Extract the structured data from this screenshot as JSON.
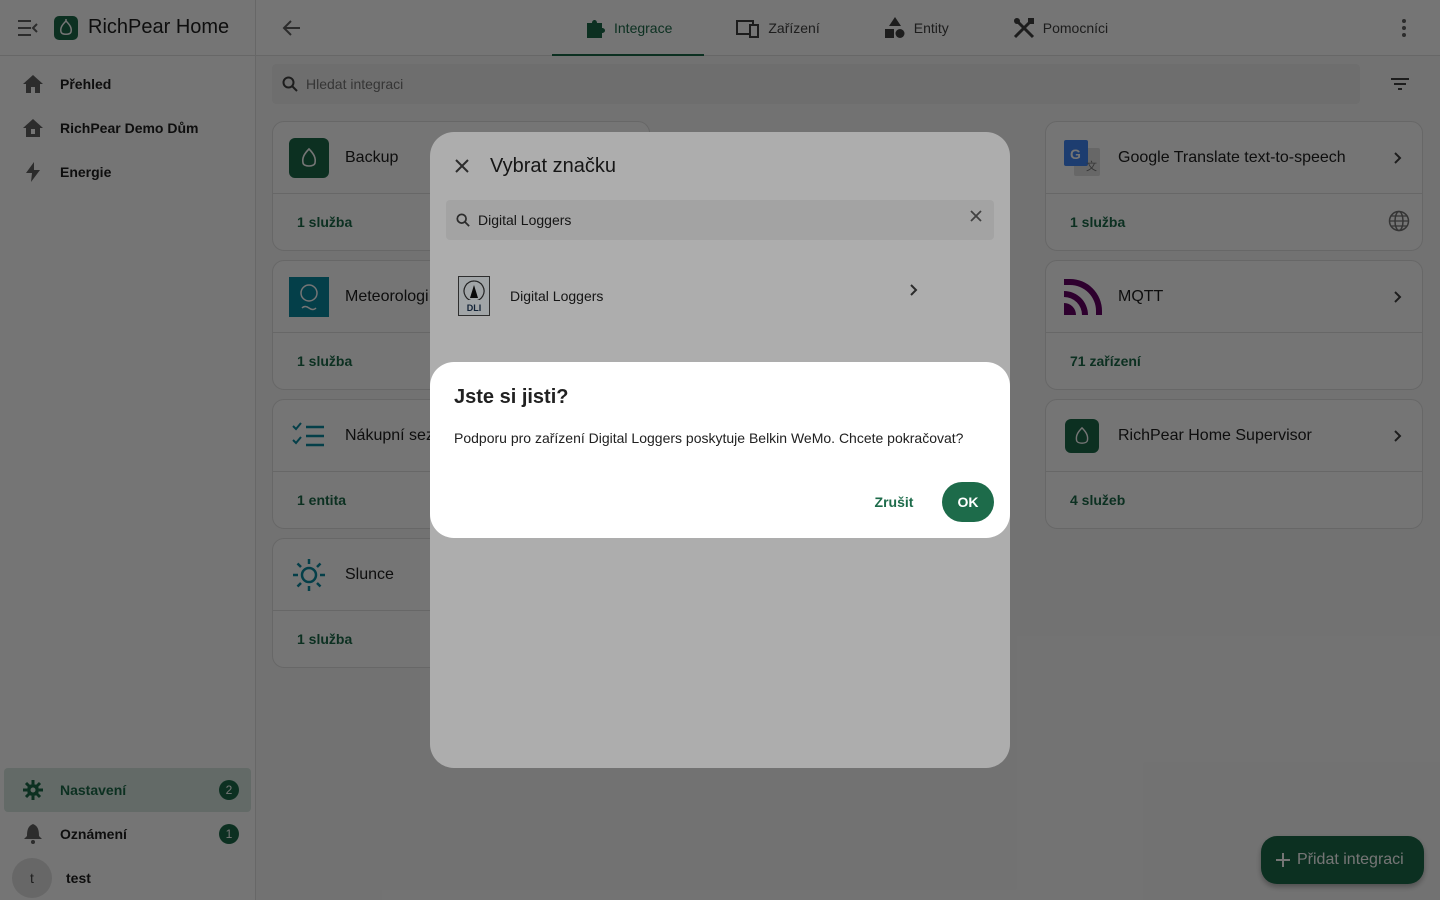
{
  "app": {
    "title": "RichPear Home"
  },
  "sidebar": {
    "items": [
      {
        "label": "Přehled",
        "icon": "home-icon"
      },
      {
        "label": "RichPear Demo Dům",
        "icon": "home-outline-icon"
      },
      {
        "label": "Energie",
        "icon": "lightning-icon"
      }
    ],
    "bottom": [
      {
        "label": "Nastavení",
        "icon": "gear-icon",
        "badge": "2"
      },
      {
        "label": "Oznámení",
        "icon": "bell-icon",
        "badge": "1"
      }
    ],
    "user": {
      "initial": "t",
      "name": "test"
    }
  },
  "tabs": [
    {
      "label": "Integrace",
      "icon": "puzzle-icon"
    },
    {
      "label": "Zařízení",
      "icon": "devices-icon"
    },
    {
      "label": "Entity",
      "icon": "shapes-icon"
    },
    {
      "label": "Pomocníci",
      "icon": "tools-icon"
    }
  ],
  "search": {
    "placeholder": "Hledat integraci"
  },
  "cards": [
    {
      "name": "Backup",
      "status": "1 služba"
    },
    {
      "name": "Google Translate text-to-speech",
      "status": "1 služba"
    },
    {
      "name": "Meteorologi",
      "status": "1 služba"
    },
    {
      "name": "MQTT",
      "status": "71 zařízení"
    },
    {
      "name": "Nákupní sez",
      "status": "1 entita"
    },
    {
      "name": "RichPear Home Supervisor",
      "status": "4 služeb"
    },
    {
      "name": "Slunce",
      "status": "1 služba"
    }
  ],
  "fab": {
    "label": "Přidat integraci"
  },
  "brand_dialog": {
    "title": "Vybrat značku",
    "search_value": "Digital Loggers",
    "result": {
      "name": "Digital Loggers",
      "logo_text": "DLI"
    }
  },
  "confirm_dialog": {
    "title": "Jste si jisti?",
    "text": "Podporu pro zařízení Digital Loggers poskytuje Belkin WeMo. Chcete pokračovat?",
    "cancel_label": "Zrušit",
    "ok_label": "OK"
  },
  "colors": {
    "primary": "#1d6b4a",
    "mqtt": "#660066",
    "meteo": "#0b8aa0"
  }
}
